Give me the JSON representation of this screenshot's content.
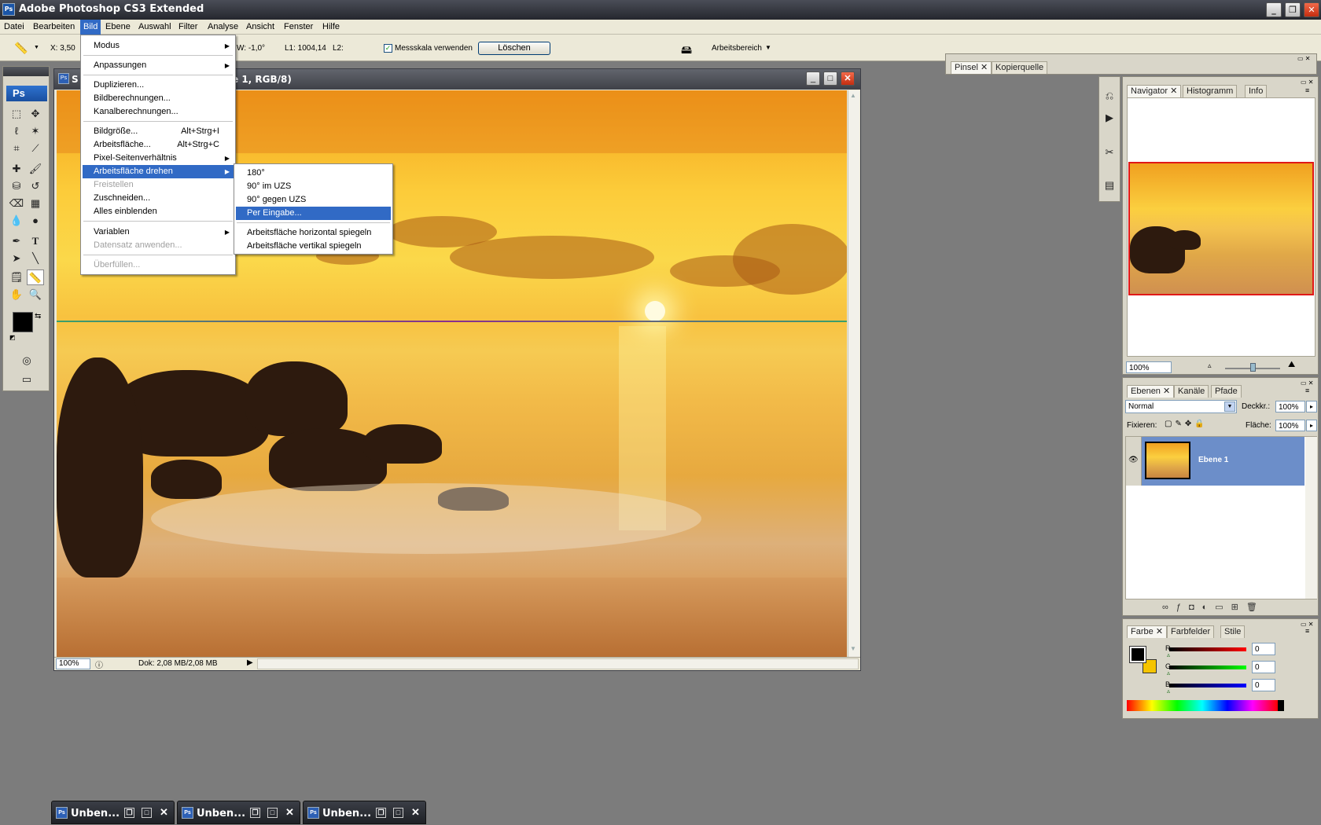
{
  "app": {
    "title": "Adobe Photoshop CS3 Extended",
    "logo": "Ps"
  },
  "menubar": [
    "Datei",
    "Bearbeiten",
    "Bild",
    "Ebene",
    "Auswahl",
    "Filter",
    "Analyse",
    "Ansicht",
    "Fenster",
    "Hilfe"
  ],
  "optbar": {
    "x": "X: 3,50",
    "w": "W: -1,0°",
    "l1": "L1: 1004,14",
    "l2": "L2:",
    "messskala": "Messskala verwenden",
    "loeschen": "Löschen",
    "arbeitsbereich": "Arbeitsbereich"
  },
  "toolbox": {
    "logo": "Ps"
  },
  "doc": {
    "title_start": "S",
    "title_end": "e 1, RGB/8)",
    "zoom": "100%",
    "status": "Dok: 2,08 MB/2,08 MB"
  },
  "bild_menu": {
    "modus": "Modus",
    "anpassungen": "Anpassungen",
    "duplizieren": "Duplizieren...",
    "bildberechnungen": "Bildberechnungen...",
    "kanalberechnungen": "Kanalberechnungen...",
    "bildgroesse": "Bildgröße...",
    "bildgroesse_sc": "Alt+Strg+I",
    "arbeitsflaeche": "Arbeitsfläche...",
    "arbeitsflaeche_sc": "Alt+Strg+C",
    "pixel": "Pixel-Seitenverhältnis",
    "drehen": "Arbeitsfläche drehen",
    "freistellen": "Freistellen",
    "zuschneiden": "Zuschneiden...",
    "alles": "Alles einblenden",
    "variablen": "Variablen",
    "datensatz": "Datensatz anwenden...",
    "ueberfuellen": "Überfüllen..."
  },
  "drehen_menu": {
    "d180": "180°",
    "d90uzs": "90° im UZS",
    "d90gegen": "90° gegen UZS",
    "per_eingabe": "Per Eingabe...",
    "horizontal": "Arbeitsfläche horizontal spiegeln",
    "vertikal": "Arbeitsfläche vertikal spiegeln"
  },
  "pinsel_panel": {
    "tab1": "Pinsel",
    "tab2": "Kopierquelle"
  },
  "navigator_panel": {
    "tab1": "Navigator",
    "tab2": "Histogramm",
    "tab3": "Info",
    "zoom": "100%"
  },
  "ebenen_panel": {
    "tab1": "Ebenen",
    "tab2": "Kanäle",
    "tab3": "Pfade",
    "mode": "Normal",
    "deckkraft_label": "Deckkr.:",
    "deckkraft": "100%",
    "fixieren": "Fixieren:",
    "flaeche_label": "Fläche:",
    "flaeche": "100%",
    "layer_name": "Ebene 1"
  },
  "farbe_panel": {
    "tab1": "Farbe",
    "tab2": "Farbfelder",
    "tab3": "Stile",
    "r_label": "R",
    "g_label": "G",
    "b_label": "B",
    "r": "0",
    "g": "0",
    "b": "0"
  },
  "minimized": [
    {
      "label": "Unben..."
    },
    {
      "label": "Unben..."
    },
    {
      "label": "Unben..."
    }
  ],
  "colors": {
    "accent": "#316ac5",
    "foreground": "#000000",
    "background": "#f5c400"
  }
}
